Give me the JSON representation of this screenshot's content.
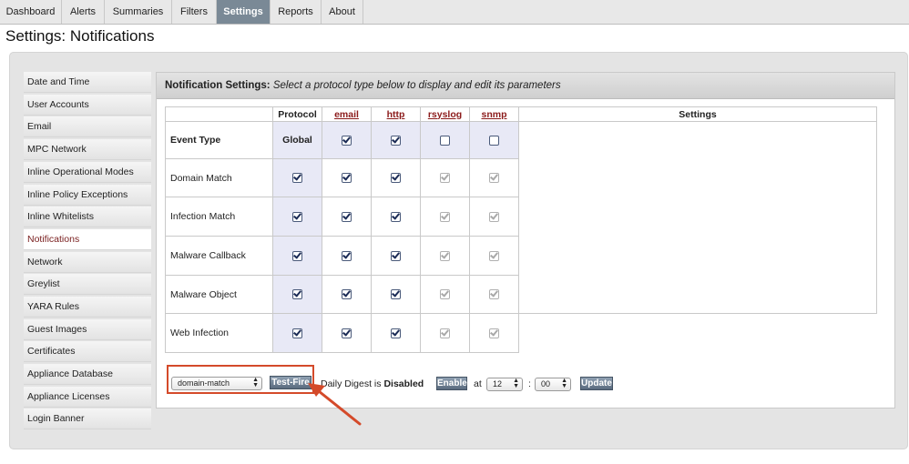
{
  "nav": {
    "tabs": [
      {
        "label": "Dashboard"
      },
      {
        "label": "Alerts"
      },
      {
        "label": "Summaries"
      },
      {
        "label": "Filters"
      },
      {
        "label": "Settings"
      },
      {
        "label": "Reports"
      },
      {
        "label": "About"
      }
    ],
    "active_tab": "Settings"
  },
  "page_title": "Settings: Notifications",
  "sidebar": {
    "items": [
      {
        "label": "Date and Time"
      },
      {
        "label": "User Accounts"
      },
      {
        "label": "Email"
      },
      {
        "label": "MPC Network"
      },
      {
        "label": "Inline Operational Modes"
      },
      {
        "label": "Inline Policy Exceptions"
      },
      {
        "label": "Inline Whitelists"
      },
      {
        "label": "Notifications"
      },
      {
        "label": "Network"
      },
      {
        "label": "Greylist"
      },
      {
        "label": "YARA Rules"
      },
      {
        "label": "Guest Images"
      },
      {
        "label": "Certificates"
      },
      {
        "label": "Appliance Database"
      },
      {
        "label": "Appliance Licenses"
      },
      {
        "label": "Login Banner"
      }
    ],
    "active": "Notifications"
  },
  "panel": {
    "title_bold": "Notification Settings:",
    "title_italic": "Select a protocol type below to display and edit its parameters"
  },
  "table": {
    "headers": {
      "protocol": "Protocol",
      "email": "email",
      "http": "http",
      "rsyslog": "rsyslog",
      "snmp": "snmp",
      "settings": "Settings"
    },
    "global_row": {
      "label": "Event Type",
      "protocol": "Global",
      "email": true,
      "http": true,
      "rsyslog": false,
      "snmp": false
    },
    "rows": [
      {
        "label": "Domain Match",
        "global": true,
        "email": true,
        "http": true,
        "rsyslog": true,
        "snmp": true
      },
      {
        "label": "Infection Match",
        "global": true,
        "email": true,
        "http": true,
        "rsyslog": true,
        "snmp": true
      },
      {
        "label": "Malware Callback",
        "global": true,
        "email": true,
        "http": true,
        "rsyslog": true,
        "snmp": true
      },
      {
        "label": "Malware Object",
        "global": true,
        "email": true,
        "http": true,
        "rsyslog": true,
        "snmp": true
      },
      {
        "label": "Web Infection",
        "global": true,
        "email": true,
        "http": true,
        "rsyslog": true,
        "snmp": true
      }
    ]
  },
  "controls": {
    "event_select": "domain-match",
    "test_fire_label": "Test-Fire",
    "digest_prefix": "Daily Digest is",
    "digest_status": "Disabled",
    "enable_label": "Enable",
    "at_label": "at",
    "hour_value": "12",
    "colon": ":",
    "minute_value": "00",
    "update_label": "Update"
  },
  "colors": {
    "active_tab": "#7a8996",
    "highlight_box": "#d44a2a",
    "protocol_link": "#8b1a1a"
  }
}
